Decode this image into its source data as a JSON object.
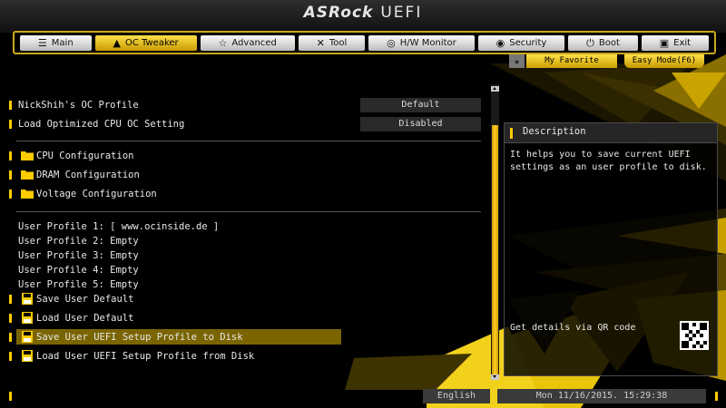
{
  "brand": {
    "logo": "ASRock",
    "suffix": "UEFI"
  },
  "tabs": [
    {
      "label": "Main",
      "icon": "list-icon"
    },
    {
      "label": "OC Tweaker",
      "icon": "flame-icon",
      "active": true
    },
    {
      "label": "Advanced",
      "icon": "star-icon"
    },
    {
      "label": "Tool",
      "icon": "tools-icon"
    },
    {
      "label": "H/W Monitor",
      "icon": "monitor-icon"
    },
    {
      "label": "Security",
      "icon": "shield-icon"
    },
    {
      "label": "Boot",
      "icon": "power-icon"
    },
    {
      "label": "Exit",
      "icon": "exit-icon"
    }
  ],
  "subnav": {
    "favorite": "My Favorite",
    "easy_mode": "Easy Mode(F6)"
  },
  "settings": [
    {
      "label": "NickShih's OC Profile",
      "value": "Default"
    },
    {
      "label": "Load Optimized CPU OC Setting",
      "value": "Disabled"
    }
  ],
  "folders": [
    "CPU Configuration",
    "DRAM Configuration",
    "Voltage Configuration"
  ],
  "profiles": [
    "User Profile 1: [ www.ocinside.de ]",
    "User Profile 2: Empty",
    "User Profile 3: Empty",
    "User Profile 4: Empty",
    "User Profile 5: Empty"
  ],
  "actions": [
    "Save User Default",
    "Load User Default",
    "Save User UEFI Setup Profile to Disk",
    "Load User UEFI Setup Profile from Disk"
  ],
  "selected_action": "Save User UEFI Setup Profile to Disk",
  "description": {
    "title": "Description",
    "text": "It helps you to save current UEFI settings as an user profile to disk.",
    "qr_label": "Get details via QR code"
  },
  "footer": {
    "language": "English",
    "datetime": "Mon 11/16/2015. 15:29:38"
  },
  "colors": {
    "accent": "#ffcc00",
    "highlight": "#7a6400",
    "panel": "#262626"
  }
}
